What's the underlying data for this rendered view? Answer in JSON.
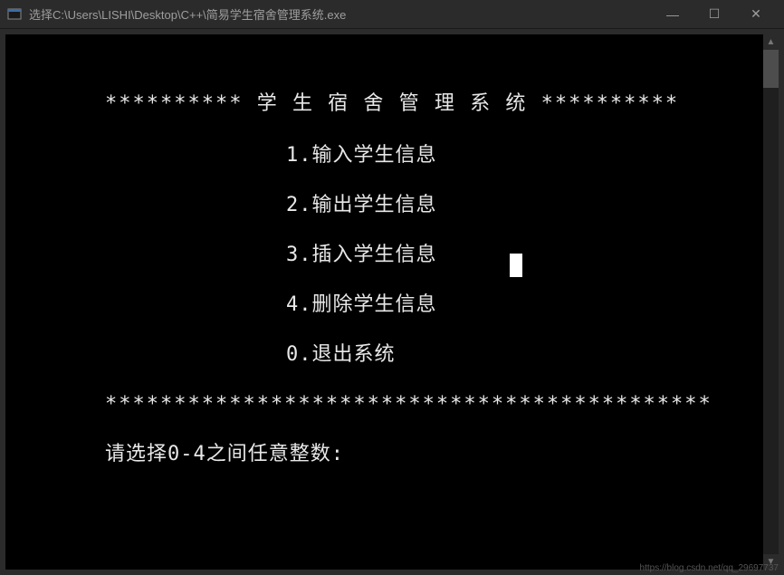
{
  "titlebar": {
    "title": "选择C:\\Users\\LISHI\\Desktop\\C++\\简易学生宿舍管理系统.exe",
    "minimize": "—",
    "maximize": "☐",
    "close": "✕"
  },
  "console": {
    "header": "********** 学 生 宿 舍 管 理 系 统 **********",
    "menu": [
      "1.输入学生信息",
      "2.输出学生信息",
      "3.插入学生信息",
      "4.删除学生信息",
      "0.退出系统"
    ],
    "footer": "********************************************",
    "prompt": "请选择0-4之间任意整数:"
  },
  "watermark": "https://blog.csdn.net/qq_29697737"
}
